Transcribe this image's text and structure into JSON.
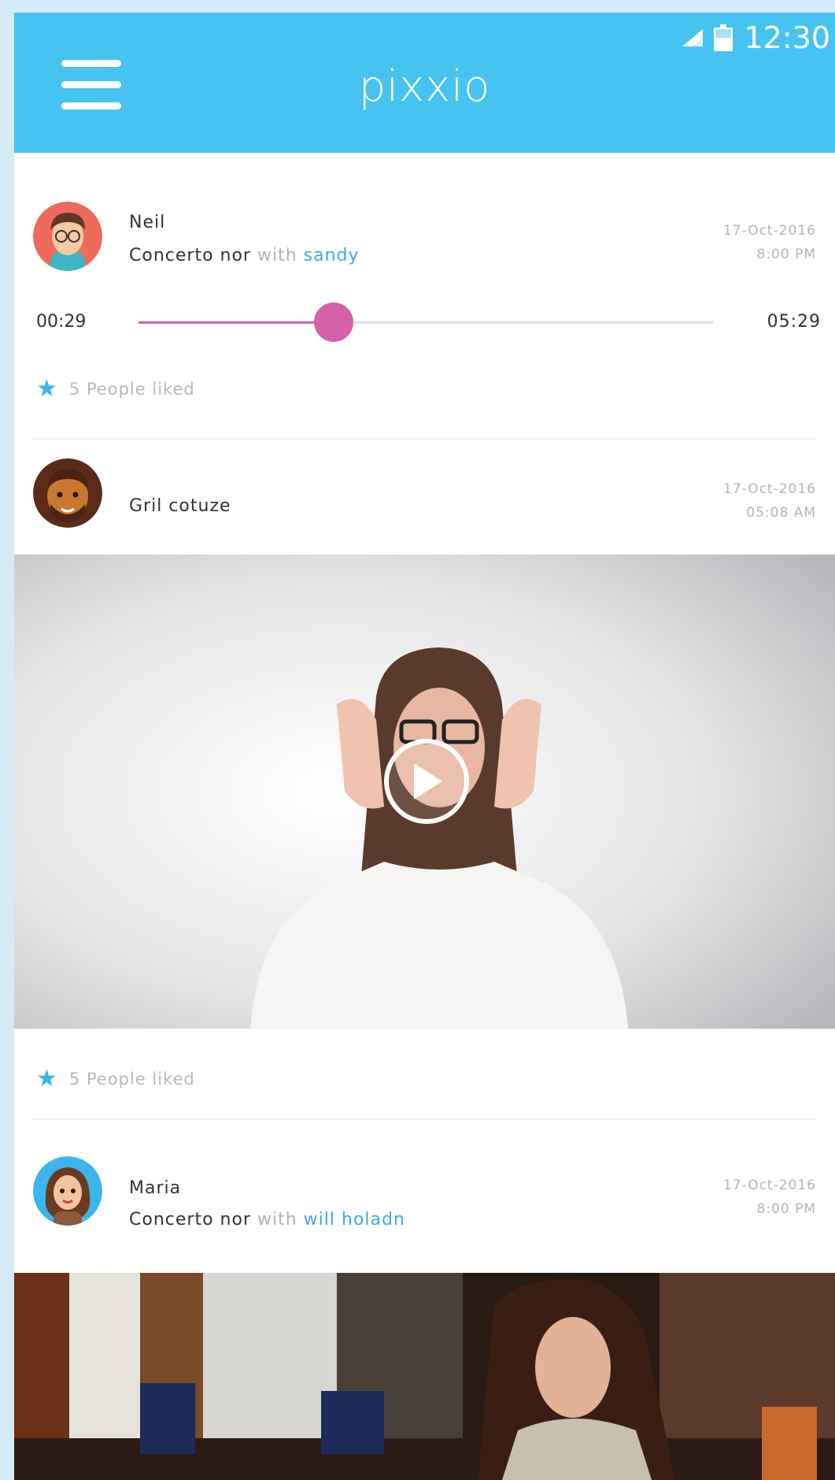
{
  "status_bar": {
    "time": "12:30",
    "signal_icon": "signal-icon",
    "battery_icon": "battery-icon"
  },
  "app_bar": {
    "title": "pixxio",
    "menu_icon": "hamburger-menu-icon"
  },
  "feed": {
    "post1": {
      "name": "Neil",
      "action": "Concerto nor",
      "with_word": "with",
      "tagged": "sandy",
      "date": "17-Oct-2016",
      "time": "8:00 PM",
      "player": {
        "elapsed": "00:29",
        "total": "05:29",
        "progress": 0.34
      },
      "likes": "5 People liked"
    },
    "post2": {
      "name": "Gril cotuze",
      "date": "17-Oct-2016",
      "time": "05:08 AM",
      "likes": "5 People liked"
    },
    "post3": {
      "name": "Maria",
      "action": "Concerto nor",
      "with_word": "with",
      "tagged": "will holadn",
      "date": "17-Oct-2016",
      "time": "8:00 PM"
    }
  },
  "colors": {
    "accent": "#46c3f1",
    "slider": "#d561a9",
    "link": "#3fa9e5",
    "star": "#3ab3ef"
  }
}
